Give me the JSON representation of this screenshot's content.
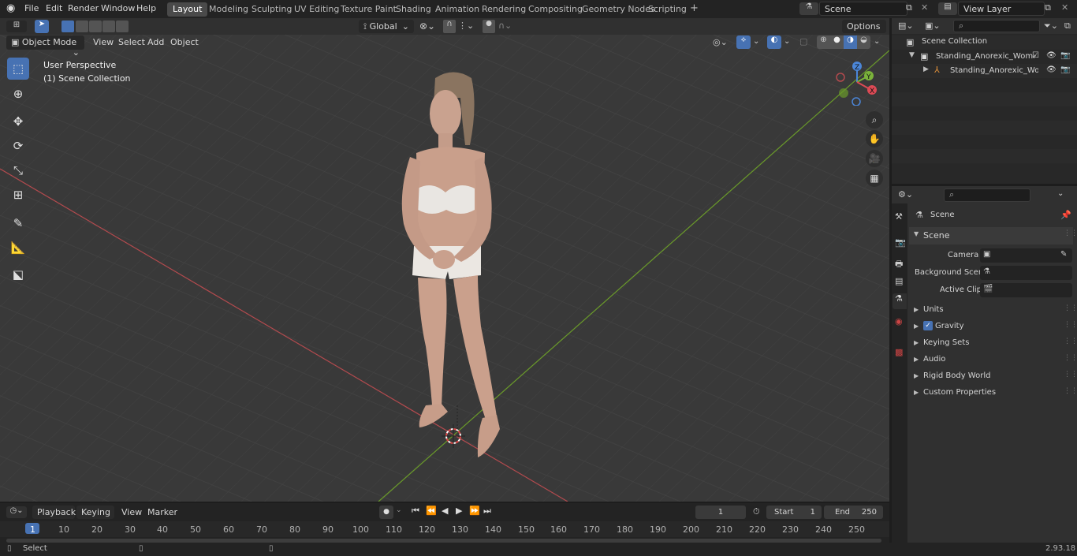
{
  "topbar": {
    "menu": [
      "File",
      "Edit",
      "Render",
      "Window",
      "Help"
    ],
    "workspaces": [
      "Layout",
      "Modeling",
      "Sculpting",
      "UV Editing",
      "Texture Paint",
      "Shading",
      "Animation",
      "Rendering",
      "Compositing",
      "Geometry Nodes",
      "Scripting"
    ],
    "active_workspace": "Layout",
    "add_tab": "+",
    "scene_name": "Scene",
    "view_layer": "View Layer"
  },
  "viewport_header": {
    "mode": "Object Mode",
    "menu": [
      "View",
      "Select",
      "Add",
      "Object"
    ],
    "transform_orientation": "Global",
    "options": "Options"
  },
  "viewport": {
    "perspective": "User Perspective",
    "collection": "(1) Scene Collection",
    "gizmo_axes": [
      "Z",
      "Y",
      "X"
    ]
  },
  "outliner": {
    "root": "Scene Collection",
    "items": [
      {
        "label": "Standing_Anorexic_Woman_C",
        "level": 1
      },
      {
        "label": "Standing_Anorexic_Wom",
        "level": 2
      }
    ]
  },
  "properties": {
    "breadcrumb": "Scene",
    "section": "Scene",
    "fields": [
      {
        "label": "Camera",
        "value": ""
      },
      {
        "label": "Background Scene",
        "value": ""
      },
      {
        "label": "Active Clip",
        "value": ""
      }
    ],
    "panels": [
      "Units",
      "Gravity",
      "Keying Sets",
      "Audio",
      "Rigid Body World",
      "Custom Properties"
    ],
    "gravity_checked": true
  },
  "timeline": {
    "menu": [
      "Playback",
      "Keying",
      "View",
      "Marker"
    ],
    "current_frame": "1",
    "start_label": "Start",
    "start": "1",
    "end_label": "End",
    "end": "250",
    "ruler": [
      "1",
      "10",
      "20",
      "30",
      "40",
      "50",
      "60",
      "70",
      "80",
      "90",
      "100",
      "110",
      "120",
      "130",
      "140",
      "150",
      "160",
      "170",
      "180",
      "190",
      "200",
      "210",
      "220",
      "230",
      "240",
      "250"
    ]
  },
  "statusbar": {
    "left": "Select",
    "version": "2.93.18"
  }
}
